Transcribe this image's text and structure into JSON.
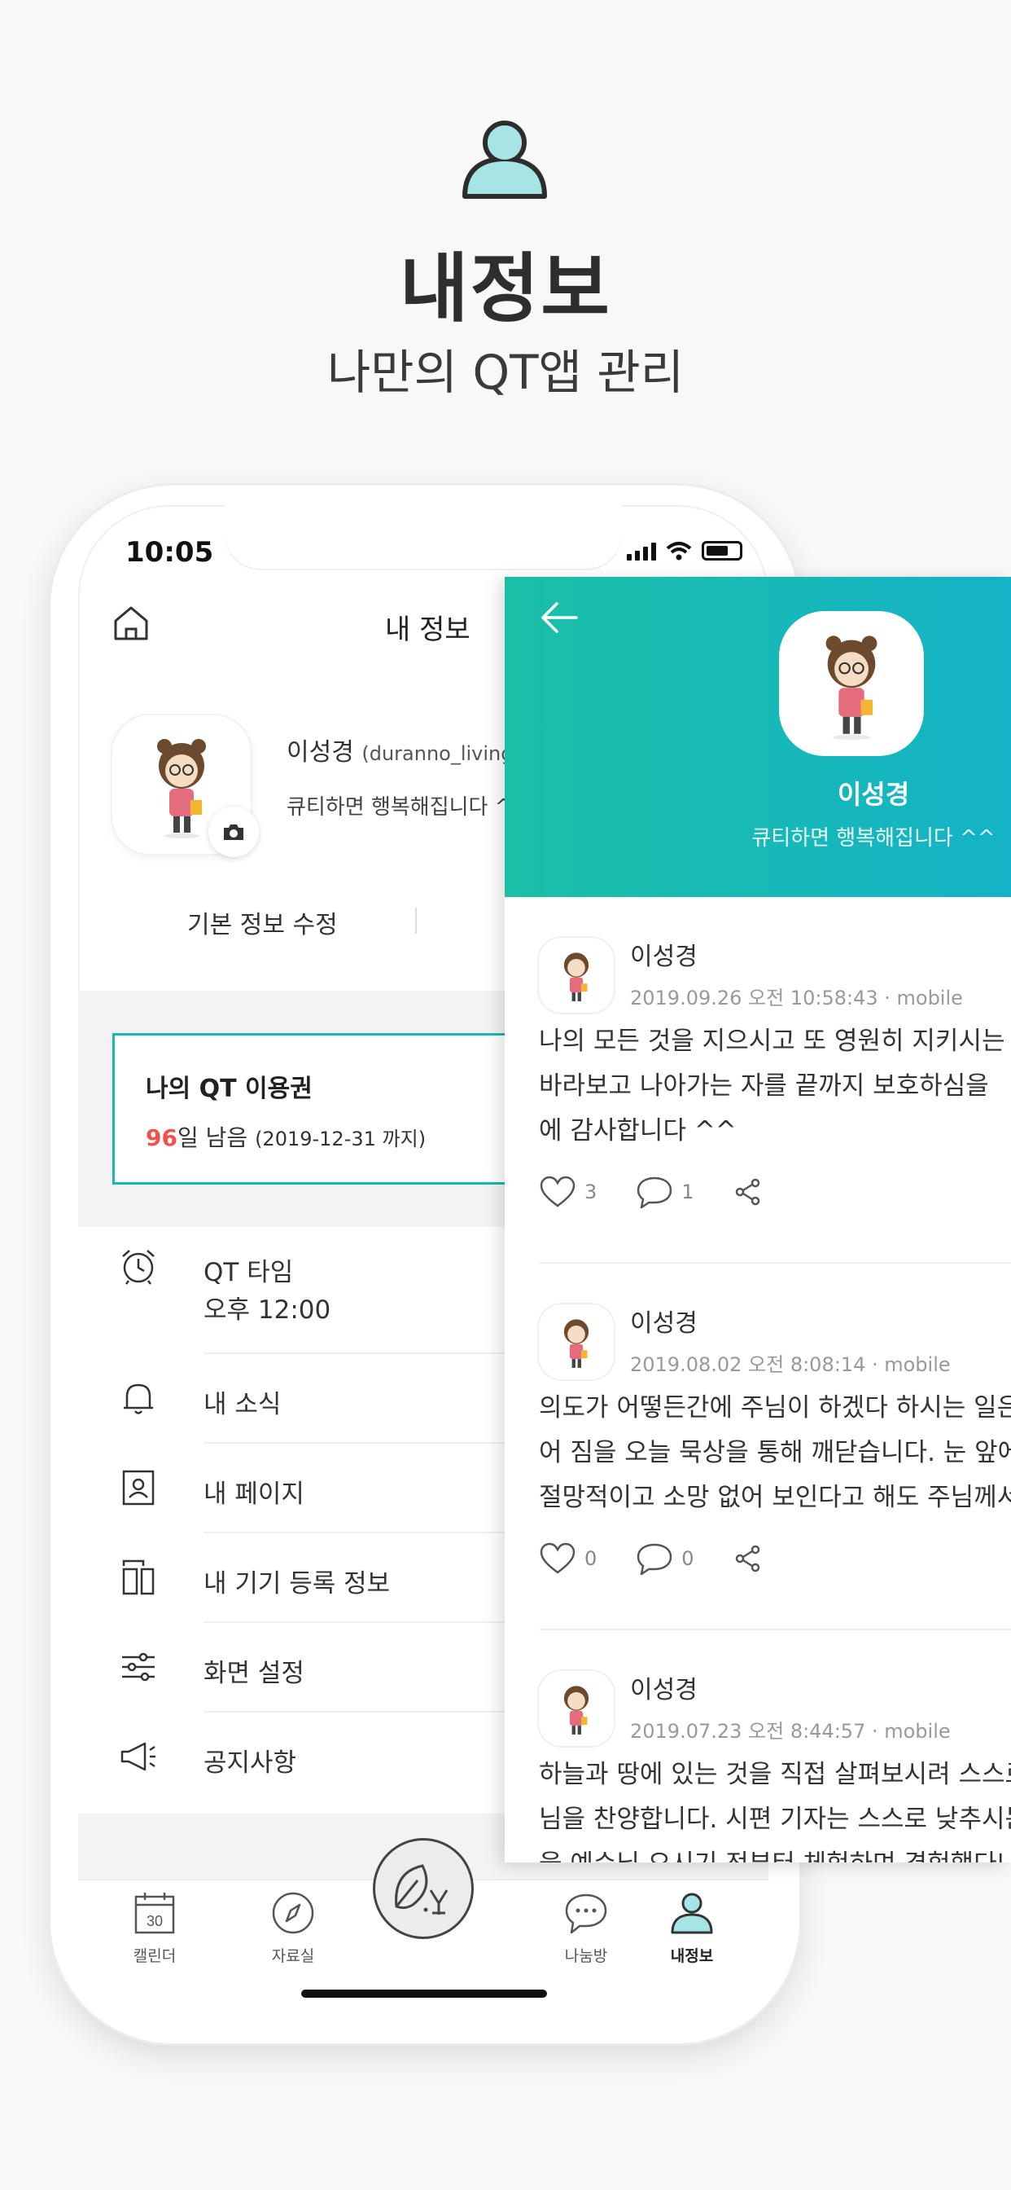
{
  "hero": {
    "title": "내정보",
    "subtitle": "나만의 QT앱 관리",
    "icon": "user-icon"
  },
  "status_bar": {
    "time": "10:05"
  },
  "profile_screen": {
    "title": "내 정보",
    "user_name": "이성경",
    "user_id": "(duranno_livingli",
    "status_message": "큐티하면 행복해집니다 ^^",
    "edit_button": "기본 정보 수정",
    "pass": {
      "title": "나의 QT 이용권",
      "days_left": "96",
      "days_suffix": "일 남음",
      "expiry": "(2019-12-31 까지)"
    },
    "menu": [
      {
        "label": "QT 타임",
        "sub": "오후 12:00",
        "icon": "alarm-clock-icon"
      },
      {
        "label": "내 소식",
        "icon": "bell-icon"
      },
      {
        "label": "내 페이지",
        "icon": "profile-card-icon"
      },
      {
        "label": "내 기기 등록 정보",
        "icon": "devices-icon"
      },
      {
        "label": "화면 설정",
        "icon": "sliders-icon"
      },
      {
        "label": "공지사항",
        "icon": "megaphone-icon"
      }
    ]
  },
  "tabbar": {
    "tabs": [
      {
        "label": "캘린더",
        "icon": "calendar-icon",
        "badge": "30"
      },
      {
        "label": "자료실",
        "icon": "compass-icon"
      },
      {
        "label": "",
        "icon": "leaf-logo-icon"
      },
      {
        "label": "나눔방",
        "icon": "chat-bubble-icon"
      },
      {
        "label": "내정보",
        "icon": "user-icon",
        "active": true
      }
    ]
  },
  "user_page": {
    "name": "이성경",
    "status_message": "큐티하면 행복해집니다 ^^",
    "posts": [
      {
        "author": "이성경",
        "date": "2019.09.26 오전 10:58:43 · mobile",
        "lines": [
          "나의 모든 것을 지으시고 또 영원히 지키시는 ",
          "바라보고 나아가는 자를 끝까지 보호하심을 ",
          "에 감사합니다 ^^"
        ],
        "likes": "3",
        "comments": "1"
      },
      {
        "author": "이성경",
        "date": "2019.08.02 오전 8:08:14 · mobile",
        "lines": [
          "의도가 어떻든간에 주님이 하겠다 하시는 일은",
          "어 짐을 오늘 묵상을 통해 깨닫습니다. 눈 앞에",
          "절망적이고 소망 없어 보인다고 해도 주님께서"
        ],
        "likes": "0",
        "comments": "0"
      },
      {
        "author": "이성경",
        "date": "2019.07.23 오전 8:44:57 · mobile",
        "lines": [
          "하늘과 땅에 있는 것을 직접 살펴보시려 스스로",
          "님을 찬양합니다. 시편 기자는 스스로 낮추시는",
          "을 예수님 오시기 전부터 체험하며 경험했다니"
        ]
      }
    ]
  },
  "colors": {
    "accent_teal": "#19b8b0",
    "head_gradient_start": "#1bbfa6",
    "head_gradient_end": "#14b3c7",
    "days_red": "#f05050",
    "user_icon_fill": "#a6e4e6"
  }
}
